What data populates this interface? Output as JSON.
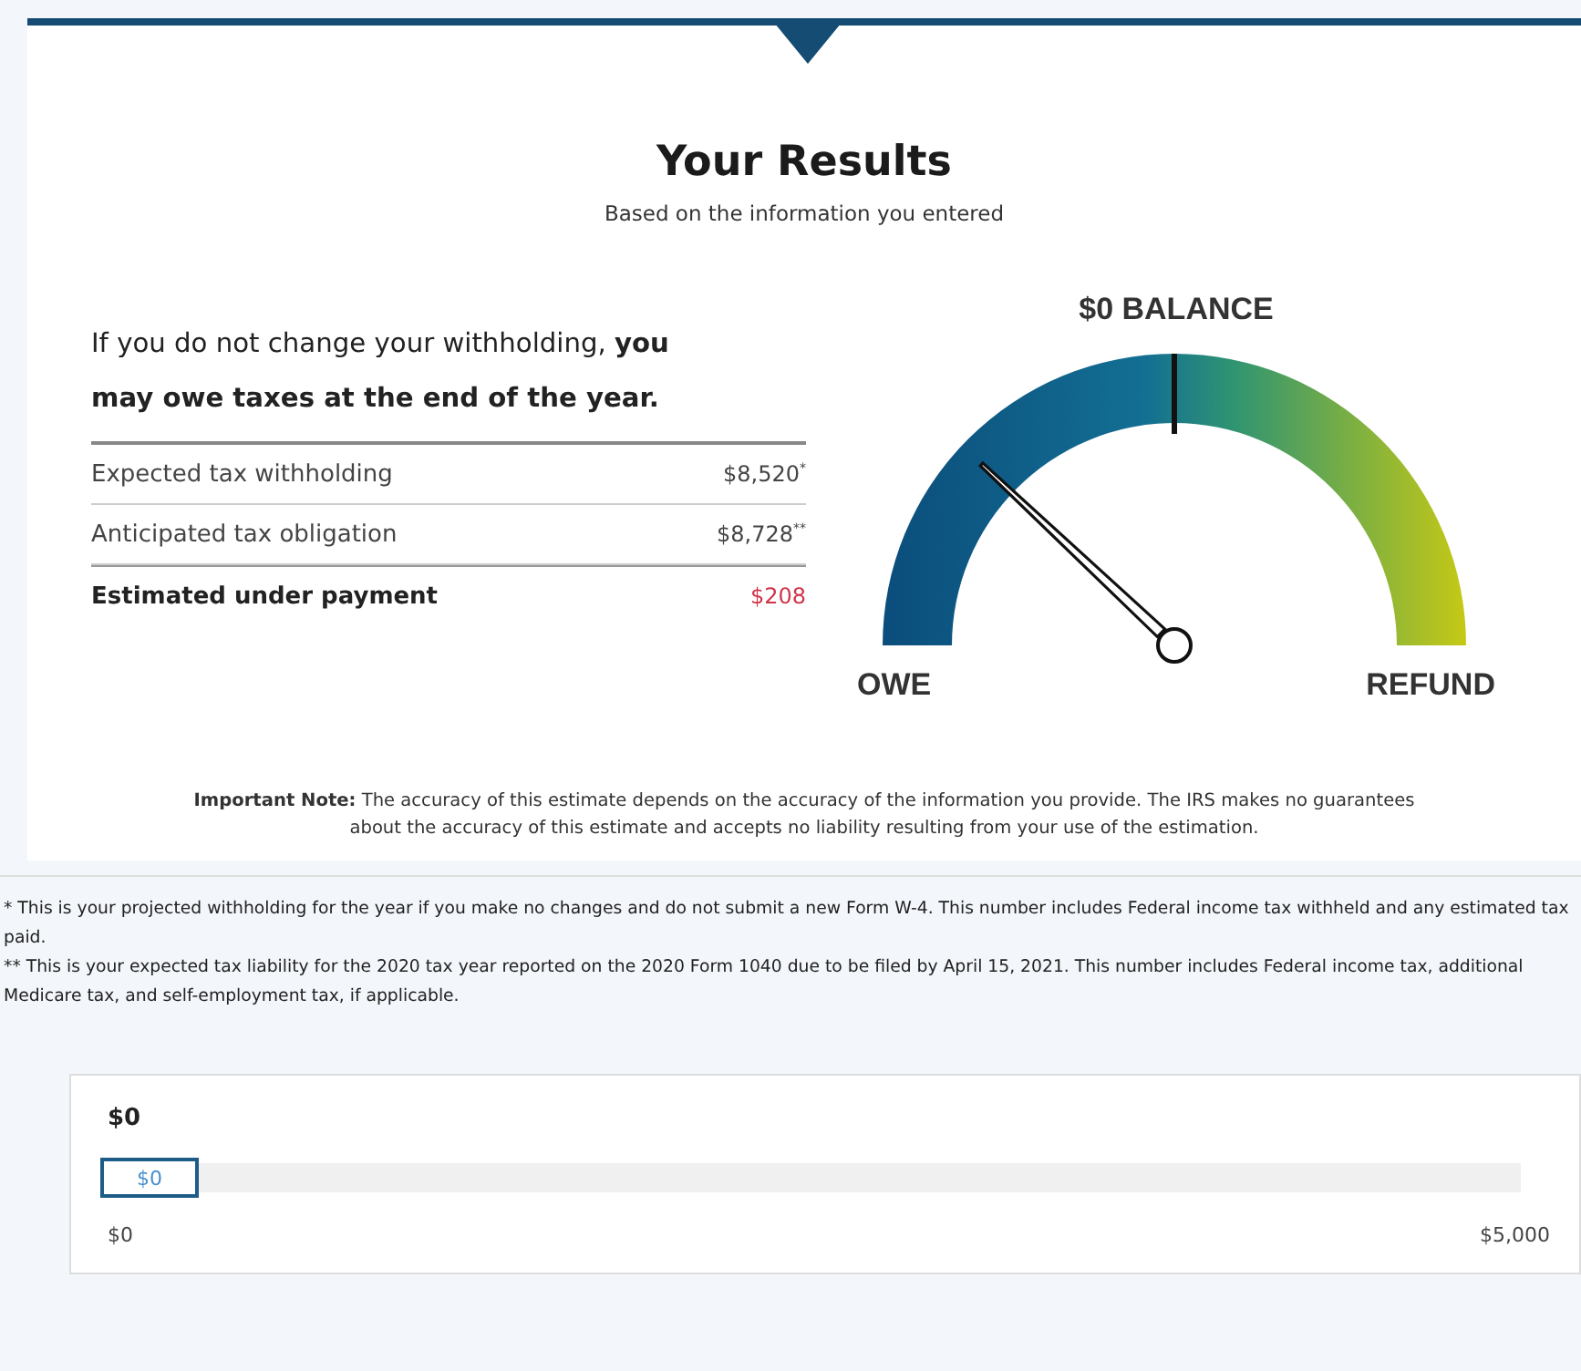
{
  "header": {
    "title": "Your Results",
    "subtitle": "Based on the information you entered"
  },
  "summary": {
    "message": "If you do not change your withholding, **you may owe taxes at the end of the year.**",
    "rows": [
      {
        "label": "Expected tax withholding",
        "value": "$8,520$^{*}$",
        "kind": "normal"
      },
      {
        "label": "Anticipated tax obligation",
        "value": "$8,728$^{**}$",
        "kind": "normal"
      },
      {
        "label": "Estimated under payment",
        "value": "$208",
        "kind": "total"
      }
    ]
  },
  "gauge": {
    "center_label": "$0 BALANCE",
    "left_label": "OWE",
    "right_label": "REFUND",
    "level": 0.24
  },
  "note": "**Important Note:** The accuracy of this estimate depends on the accuracy of the information you provide. The IRS makes no guarantees about the accuracy of this estimate and accepts no liability resulting from your use of the estimation.",
  "footnotes": [
    "* This is your projected withholding for the year if you make no changes and do not submit a new Form W-4. This number includes Federal income tax withheld and any estimated tax paid.",
    "** This is your expected tax liability for the 2020 tax year reported on the 2020 Form 1040 due to be filed by April 15, 2021. This number includes Federal income tax, additional Medicare tax, and self-employment tax, if applicable."
  ],
  "slider": {
    "heading": "$0",
    "value": "$0",
    "level": 0,
    "min_label": "$0",
    "max_label": "$5,000"
  }
}
